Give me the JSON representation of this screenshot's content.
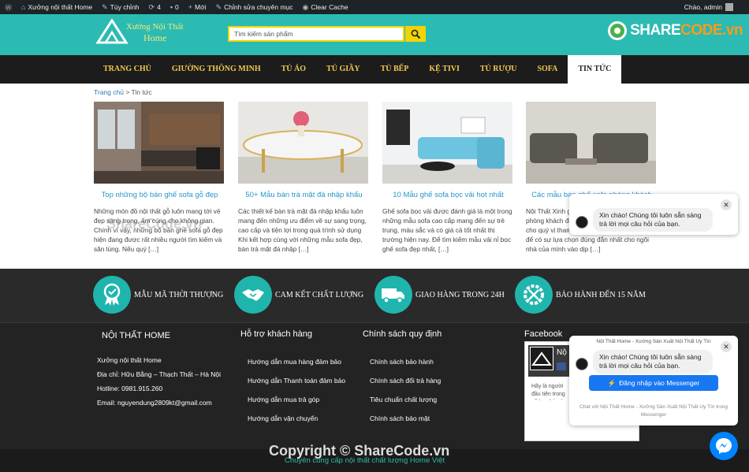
{
  "adminbar": {
    "site": "Xưởng nội thất Home",
    "customize": "Tùy chỉnh",
    "updates": "4",
    "comments": "0",
    "new": "Mới",
    "edit": "Chỉnh sửa chuyên mục",
    "cache": "Clear Cache",
    "greeting": "Chào, admin"
  },
  "header": {
    "logo_line1": "Xưởng Nội Thất",
    "logo_line2": "Home",
    "search_placeholder": "Tìm kiếm sản phẩm",
    "brand_share": "SHARE",
    "brand_code": "CODE.vn"
  },
  "nav": {
    "items": [
      "TRANG CHỦ",
      "GIƯỜNG THÔNG MINH",
      "TỦ ÁO",
      "TỦ GIẦY",
      "TỦ BẾP",
      "KỆ TIVI",
      "TỦ RƯỢU",
      "SOFA",
      "TIN TỨC"
    ],
    "active": "TIN TỨC"
  },
  "breadcrumb": {
    "home": "Trang chủ",
    "sep": ">",
    "current": "Tin tức"
  },
  "watermark": "ShareCode.vn",
  "posts": [
    {
      "title": "Top những bộ bàn ghế sofa gỗ đẹp",
      "excerpt": "Những món đồ nội thất gỗ luôn mang tới vẻ đẹp sang trọng, ấm cúng cho không gian. Chính vì vậy, những bộ bàn ghế sofa gỗ đẹp hiện đang được rất nhiều người tìm kiếm và săn lùng. Nếu quý […]"
    },
    {
      "title": "50+ Mẫu bàn trà mặt đá nhập khẩu",
      "excerpt": "Các thiết kế bàn trà mặt đá nhập khẩu luôn mang đến những ưu điểm về sự sang trọng, cao cấp và tiện lợi trong quá trình sử dụng Khi kết hợp cùng với những mẫu sofa đẹp, bàn trà mặt đá nhập […]"
    },
    {
      "title": "10 Mẫu ghế sofa bọc vải hot nhất",
      "excerpt": "Ghế sofa bọc vải được đánh giá là một trong những mẫu sofa cao cấp mang đến sự trẻ trung, màu sắc và có giá cả tốt nhất thị trường hiện nay. Để tìm kiếm mẫu vải nỉ bọc ghế sofa đẹp nhất, […]"
    },
    {
      "title": "Các mẫu bàn ghế sofa phòng khách",
      "excerpt": "Nội Thất Xinh gợi ý những mẫu bàn ghế sofa phòng khách đẹp, hiện đại và mới nhất 2020 cho quý vị tham khảo. Hãy cùng xem ngay để có sự lựa chọn đúng đắn nhất cho ngôi nhà của mình vào dịp […]"
    }
  ],
  "features": [
    {
      "label": "MẪU MÃ THỜI THƯỢNG",
      "icon": "award-icon"
    },
    {
      "label": "CAM KẾT CHẤT LƯỢNG",
      "icon": "handshake-icon"
    },
    {
      "label": "GIAO HÀNG TRONG 24H",
      "icon": "truck-icon"
    },
    {
      "label": "BẢO HÀNH ĐẾN 15 NĂM",
      "icon": "tools-icon"
    }
  ],
  "footer": {
    "col1": {
      "title": "NỘI THẤT HOME",
      "lines": [
        "Xưởng nội thất Home",
        "Địa chỉ: Hữu Bằng – Thạch Thất – Hà Nội",
        "Hotline: 0981.915.260",
        "Email: nguyendung2809kt@gmail.com"
      ]
    },
    "col2": {
      "title": "Hỗ trợ khách hàng",
      "links": [
        "Hướng dẫn mua hàng đảm bảo",
        "Hướng dẫn Thanh toán đảm bảo",
        "Hướng dẫn mua trả góp",
        "Hướng dẫn vận chuyển"
      ]
    },
    "col3": {
      "title": "Chính sách quy định",
      "links": [
        "Chính sách bảo hành",
        "Chính sách đổi trả hàng",
        "Tiêu chuẩn chất lượng",
        "Chính sách bảo mật"
      ]
    },
    "col4": {
      "title": "Facebook",
      "page_short": "Nộ",
      "snippet": "Hãy là người đầu tiên trong số bạn bè của bạn thích nội dung này"
    }
  },
  "copyright": {
    "line1": "Copyright © ShareCode.vn",
    "line2": "Chuyên cung cấp nội thất chất lượng Home Việt"
  },
  "chat1": {
    "header": "Nội Thất Home - Xưởng Sản Xuất Nội Thất Uy Tín",
    "message": "Xin chào! Chúng tôi luôn sẵn sàng trả lời mọi câu hỏi của bạn.",
    "close": "✕"
  },
  "chat2": {
    "header": "Nội Thất Home - Xưởng Sản Xuất Nội Thất Uy Tín",
    "message": "Xin chào! Chúng tôi luôn sẵn sàng trả lời mọi câu hỏi của bạn.",
    "login_button": "Đăng nhập vào Messenger",
    "footer_note": "Chat với Nội Thất Home - Xưởng Sản Xuất Nội Thất Uy Tín trong Messenger",
    "close": "✕"
  },
  "colors": {
    "teal": "#2bbbb2",
    "nav_bg": "#1c1c1c",
    "gold": "#f2c94c",
    "link": "#2a95c9",
    "messenger": "#0084ff"
  }
}
